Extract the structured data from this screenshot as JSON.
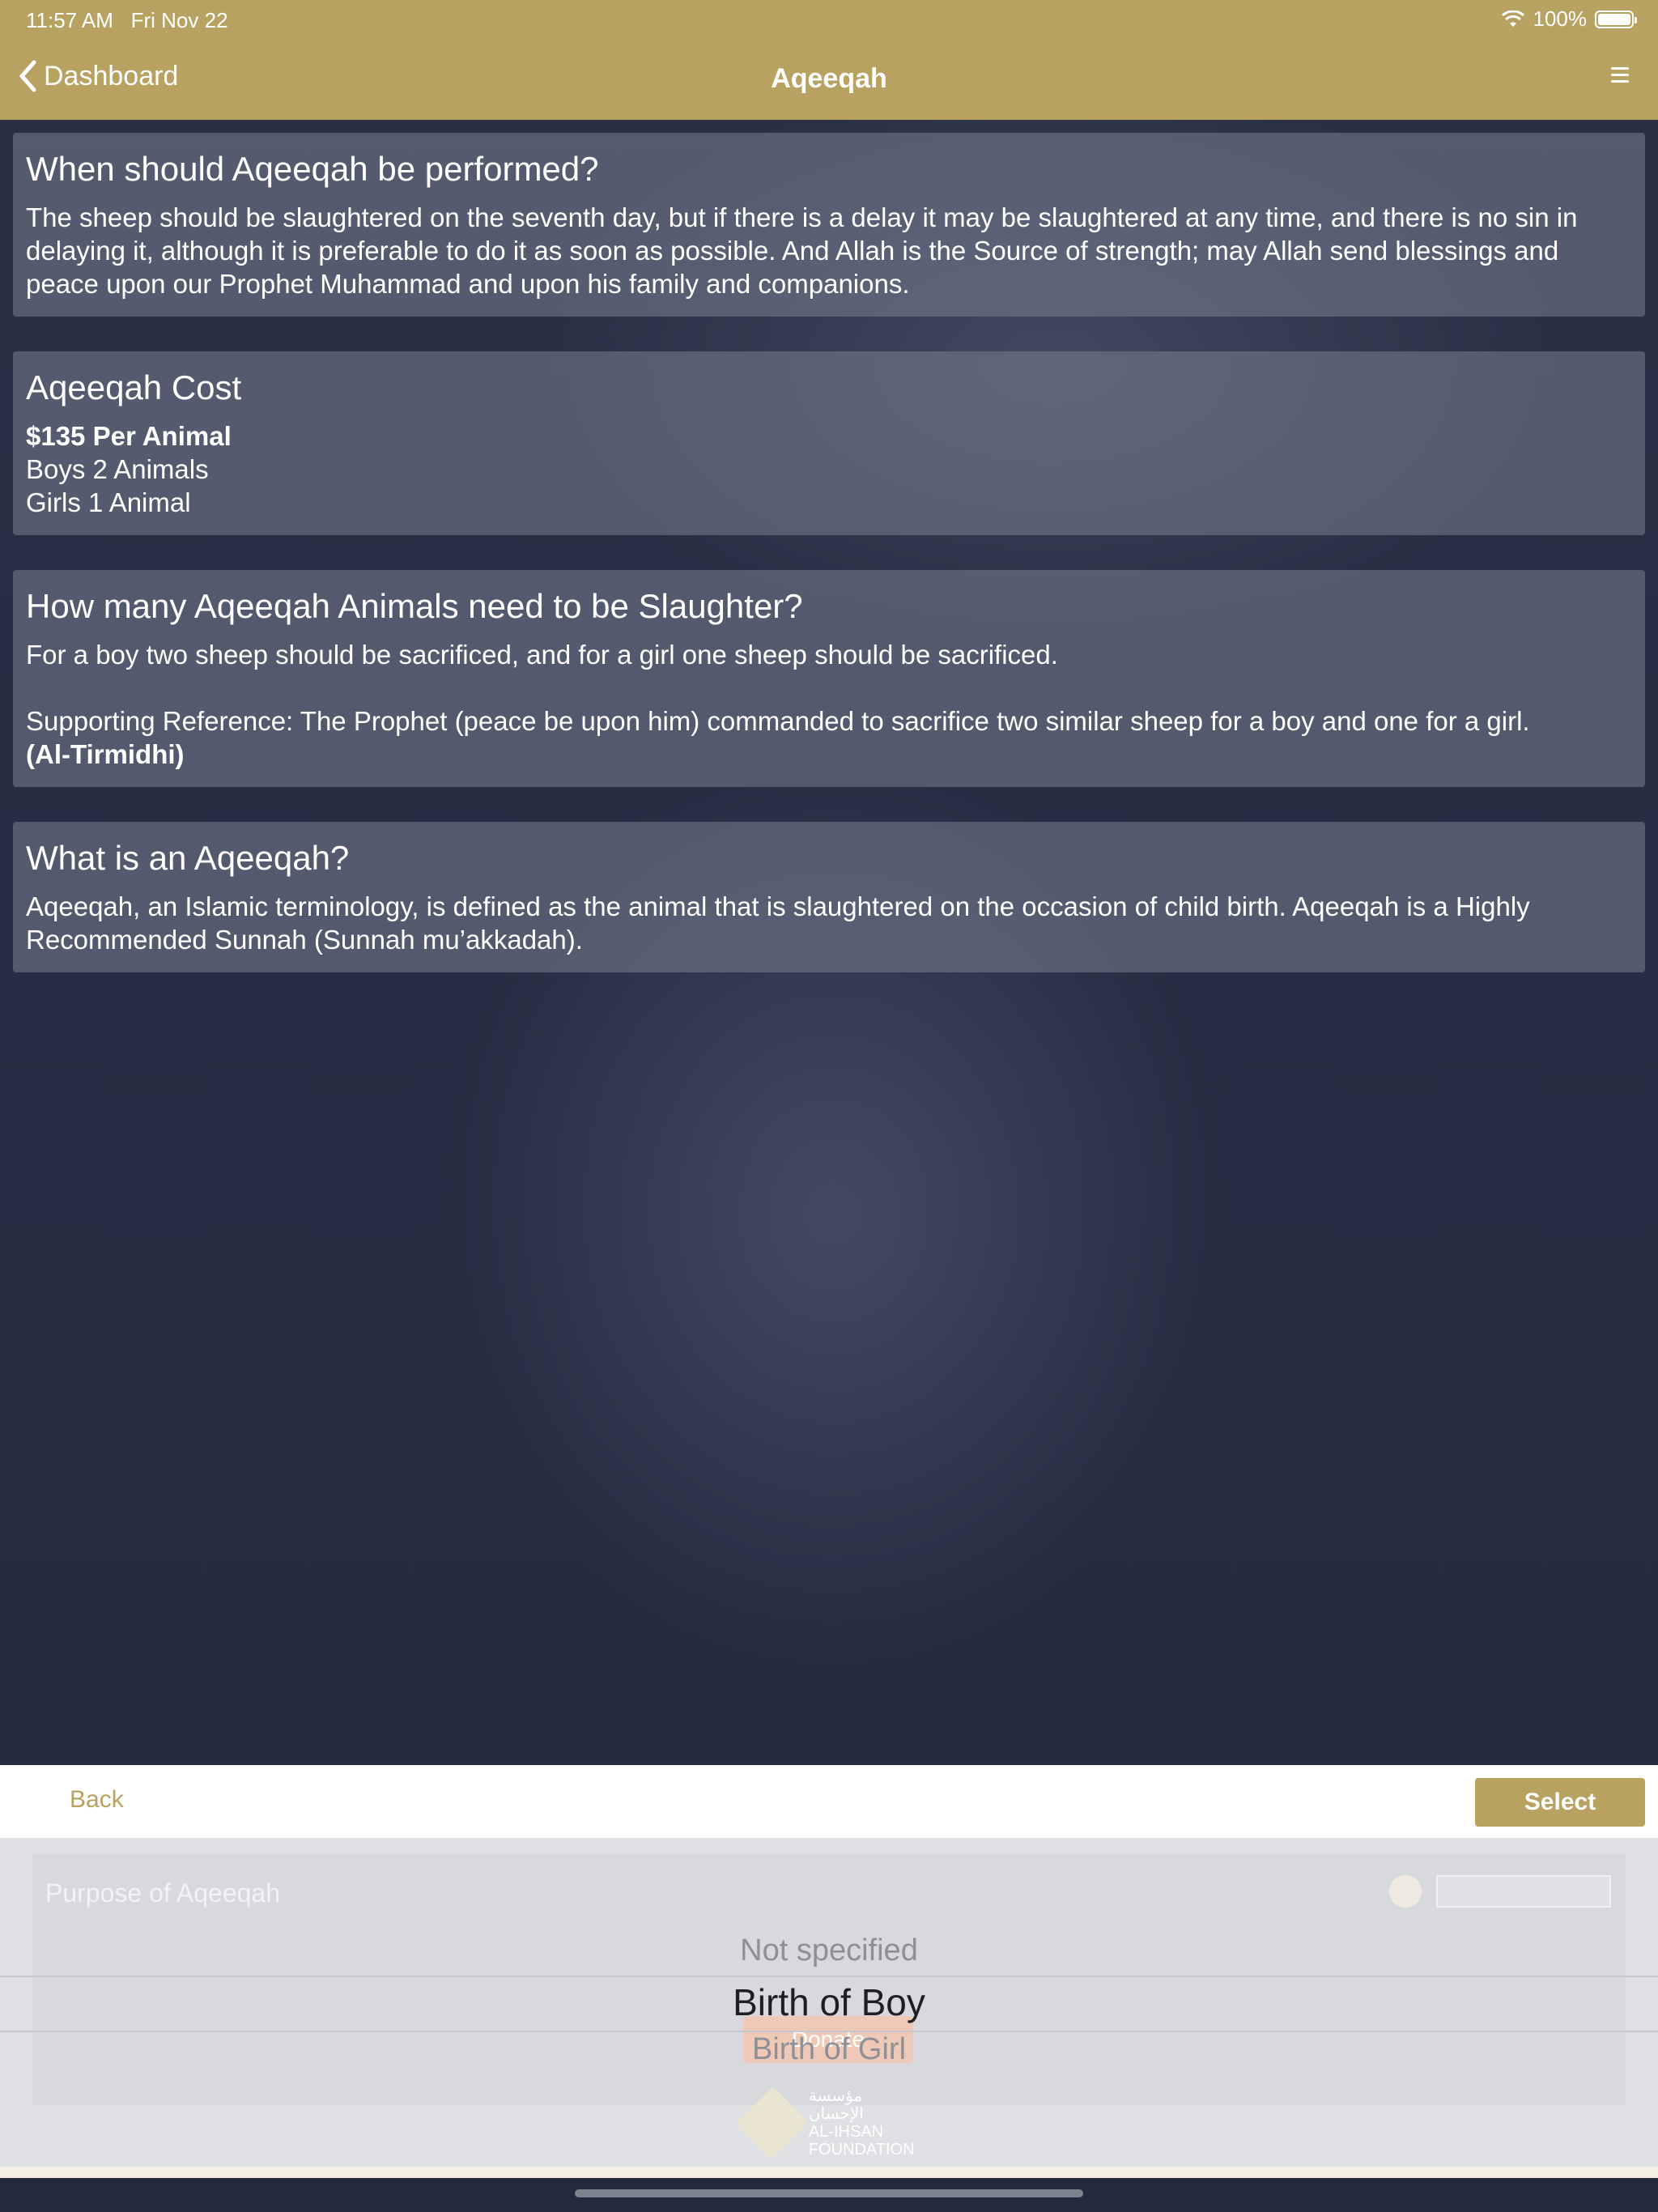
{
  "status_bar": {
    "time": "11:57 AM",
    "date": "Fri Nov 22",
    "battery": "100%"
  },
  "nav": {
    "back_label": "Dashboard",
    "title": "Aqeeqah"
  },
  "cards": [
    {
      "title": "When should Aqeeqah be performed?",
      "body": "The sheep should be slaughtered on the seventh day, but if there is a delay it may be slaughtered at any time, and there is no sin in delaying it, although it is preferable to do it as soon as possible. And Allah is the Source of strength; may Allah send blessings and peace upon our Prophet Muhammad and upon his family and companions."
    },
    {
      "title": "Aqeeqah Cost",
      "price": "$135 Per Animal",
      "boys": "Boys 2 Animals",
      "girls": "Girls 1 Animal"
    },
    {
      "title": "How many Aqeeqah Animals need to be Slaughter?",
      "body": "For a boy two sheep should be sacrificed, and for a girl one sheep should be sacrificed.",
      "reference": "Supporting Reference: The Prophet (peace be upon him) commanded to sacrifice two similar sheep for a boy and one for a girl.",
      "source": "(Al-Tirmidhi)"
    },
    {
      "title": "What is an Aqeeqah?",
      "body": "Aqeeqah, an Islamic terminology, is defined as the animal that is slaughtered on the occasion of child birth. Aqeeqah is a Highly Recommended Sunnah (Sunnah mu’akkadah)."
    }
  ],
  "picker_toolbar": {
    "back_label": "Back",
    "select_label": "Select"
  },
  "underlying_form": {
    "label": "Purpose of Aqeeqah",
    "donate_label": "Donate",
    "logo_arabic": "مؤسسة الإحسان",
    "logo_line1": "AL-IHSAN",
    "logo_line2": "FOUNDATION"
  },
  "picker": {
    "options": [
      "Not specified",
      "Birth of Boy",
      "Birth of Girl"
    ],
    "selected": "Birth of Boy"
  }
}
